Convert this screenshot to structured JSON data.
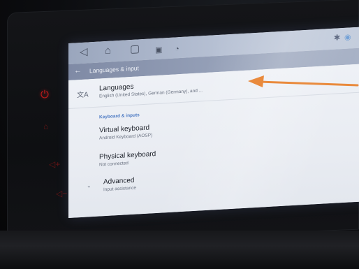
{
  "nav": {
    "back_icon": "back-triangle-icon",
    "home_icon": "home-icon",
    "recents_icon": "recents-icon",
    "screenshot_icon": "screenshot-icon",
    "volume_icon": "volume-icon"
  },
  "status": {
    "bluetooth_icon": "bluetooth-icon",
    "wifi_icon": "wifi-icon"
  },
  "appbar": {
    "title": "Languages & input"
  },
  "settings": {
    "languages": {
      "title": "Languages",
      "summary": "English (United States), German (Germany), and ..."
    },
    "section_header": "Keyboard & inputs",
    "virtual_keyboard": {
      "title": "Virtual keyboard",
      "summary": "Android Keyboard (AOSP)"
    },
    "physical_keyboard": {
      "title": "Physical keyboard",
      "summary": "Not connected"
    },
    "advanced": {
      "title": "Advanced",
      "summary": "Input assistance"
    }
  },
  "hardware_buttons": [
    "power-icon",
    "home-outline-icon",
    "volume-up-icon",
    "volume-down-icon"
  ],
  "colors": {
    "annotation_arrow": "#e98a3c",
    "hardware_button_red": "#c01b1b",
    "section_header_blue": "#4a78c2"
  }
}
